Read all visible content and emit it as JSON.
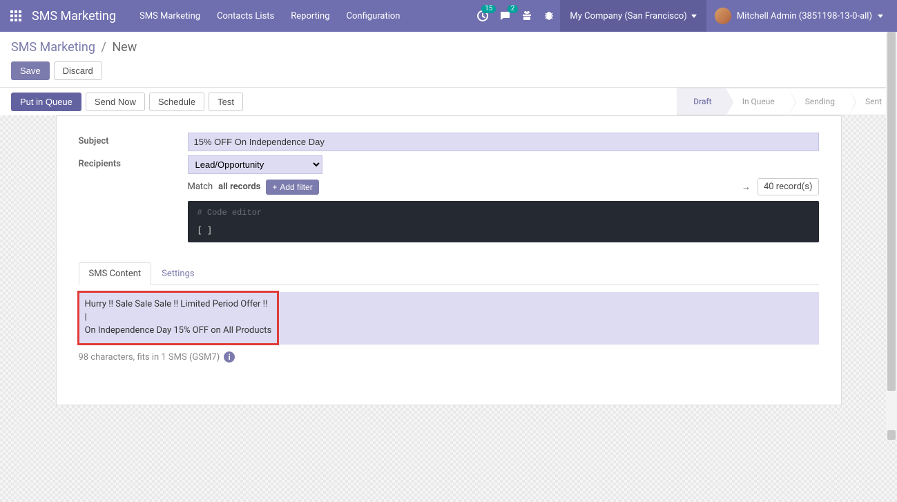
{
  "navbar": {
    "brand": "SMS Marketing",
    "links": [
      "SMS Marketing",
      "Contacts Lists",
      "Reporting",
      "Configuration"
    ],
    "activity_badge": "15",
    "discuss_badge": "2",
    "company": "My Company (San Francisco)",
    "user": "Mitchell Admin (3851198-13-0-all)"
  },
  "breadcrumb": {
    "parent": "SMS Marketing",
    "current": "New"
  },
  "buttons": {
    "save": "Save",
    "discard": "Discard",
    "put_in_queue": "Put in Queue",
    "send_now": "Send Now",
    "schedule": "Schedule",
    "test": "Test"
  },
  "status": {
    "items": [
      "Draft",
      "In Queue",
      "Sending",
      "Sent"
    ],
    "active_index": 0
  },
  "form": {
    "subject_label": "Subject",
    "subject_value": "15% OFF On Independence Day",
    "recipients_label": "Recipients",
    "recipients_value": "Lead/Opportunity",
    "match_prefix": "Match",
    "match_bold": "all records",
    "add_filter": "Add filter",
    "record_count": "40 record(s)",
    "code_comment": "# Code editor",
    "code_body": "[ ]"
  },
  "tabs": {
    "items": [
      "SMS Content",
      "Settings"
    ],
    "active_index": 0
  },
  "sms": {
    "body": "Hurry !! Sale Sale Sale !! Limited Period Offer !!\n|\nOn Independence Day 15% OFF on All Products",
    "meter": "98 characters, fits in 1 SMS (GSM7)"
  }
}
